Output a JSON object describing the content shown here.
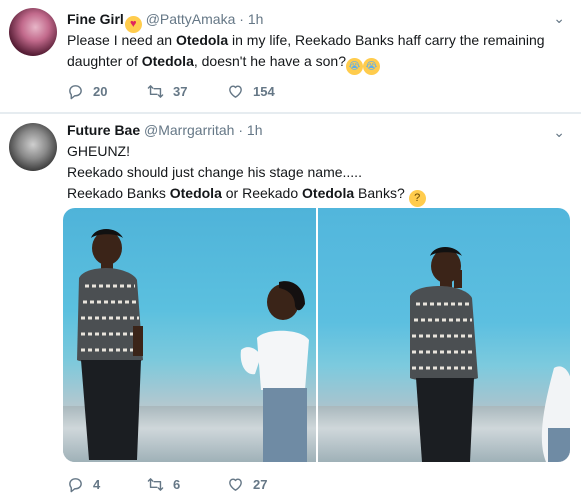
{
  "tweets": [
    {
      "name": "Fine Girl",
      "name_emoji": "heart-eyes-emoji",
      "handle": "@PattyAmaka",
      "dot": "·",
      "time": "1h",
      "text_parts": [
        "Please I need an ",
        "Otedola",
        " in my life, Reekado Banks haff carry the remaining daughter of ",
        "Otedola",
        ", doesn't he have a son?"
      ],
      "text_emojis": [
        "loudly-crying-emoji",
        "loudly-crying-emoji"
      ],
      "actions": {
        "replies": "20",
        "retweets": "37",
        "likes": "154"
      }
    },
    {
      "name": "Future Bae",
      "handle": "@Marrgarritah",
      "dot": "·",
      "time": "1h",
      "line1": "GHEUNZ!",
      "line2": "Reekado should just change his stage name.....",
      "line3_parts": [
        "Reekado Banks ",
        "Otedola",
        " or Reekado ",
        "Otedola",
        " Banks?"
      ],
      "line3_emoji": "thinking-face-emoji",
      "actions": {
        "replies": "4",
        "retweets": "6",
        "likes": "27"
      }
    }
  ],
  "colors": {
    "text_primary": "#14171a",
    "text_secondary": "#657786",
    "background": "#e6ecf0",
    "card": "#ffffff"
  }
}
